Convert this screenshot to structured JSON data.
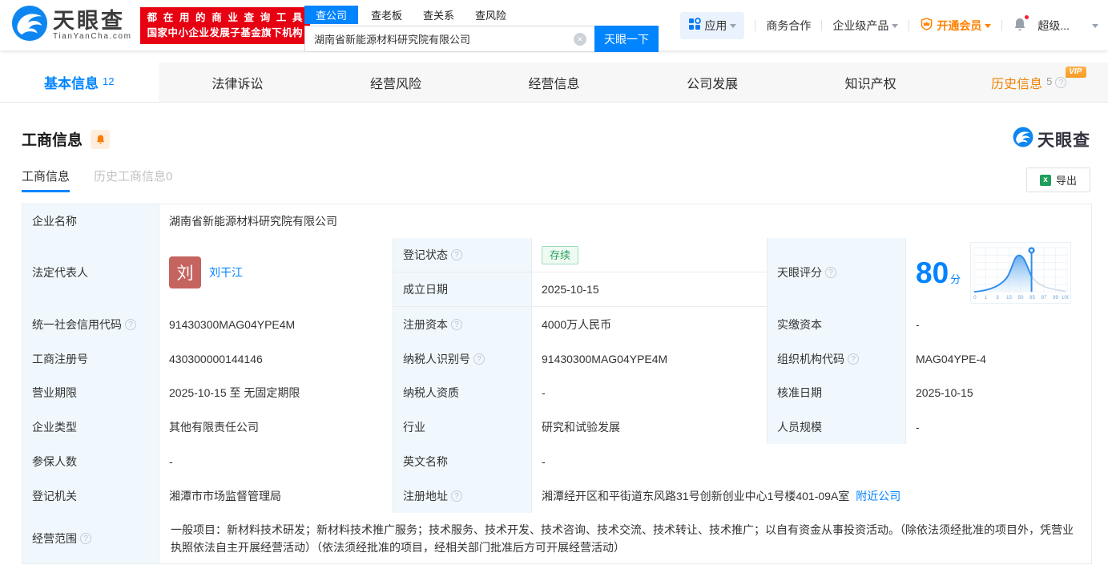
{
  "header": {
    "logo": {
      "name": "天眼查",
      "domain": "TianYanCha.com"
    },
    "promo": {
      "line1": "都在用的商业查询工具",
      "line2": "国家中小企业发展子基金旗下机构"
    },
    "search": {
      "tabs": [
        {
          "label": "查公司",
          "active": true
        },
        {
          "label": "查老板",
          "active": false
        },
        {
          "label": "查关系",
          "active": false
        },
        {
          "label": "查风险",
          "active": false
        }
      ],
      "value": "湖南省新能源材料研究院有限公司",
      "button": "天眼一下"
    },
    "nav": {
      "apps": "应用",
      "cooperation": "商务合作",
      "enterprise": "企业级产品",
      "vip": "开通会员",
      "more": "超级..."
    }
  },
  "tabs": [
    {
      "label": "基本信息",
      "count": "12"
    },
    {
      "label": "法律诉讼",
      "count": ""
    },
    {
      "label": "经营风险",
      "count": ""
    },
    {
      "label": "经营信息",
      "count": ""
    },
    {
      "label": "公司发展",
      "count": ""
    },
    {
      "label": "知识产权",
      "count": ""
    },
    {
      "label": "历史信息",
      "count": "5",
      "vip": "VIP"
    }
  ],
  "section": {
    "title": "工商信息",
    "watermark": "天眼查",
    "subtabs": [
      {
        "label": "工商信息",
        "active": true
      },
      {
        "label": "历史工商信息0",
        "active": false
      }
    ],
    "export_label": "导出"
  },
  "company": {
    "name_label": "企业名称",
    "name": "湖南省新能源材料研究院有限公司",
    "legal_rep_label": "法定代表人",
    "legal_rep_avatar": "刘",
    "legal_rep": "刘干江",
    "reg_status_label": "登记状态",
    "reg_status": "存续",
    "establish_date_label": "成立日期",
    "establish_date": "2025-10-15",
    "score_label": "天眼评分",
    "score": "80",
    "score_unit": "分",
    "credit_code_label": "统一社会信用代码",
    "credit_code": "91430300MAG04YPE4M",
    "reg_capital_label": "注册资本",
    "reg_capital": "4000万人民币",
    "paid_capital_label": "实缴资本",
    "paid_capital": "-",
    "reg_number_label": "工商注册号",
    "reg_number": "430300000144146",
    "taxpayer_id_label": "纳税人识别号",
    "taxpayer_id": "91430300MAG04YPE4M",
    "org_code_label": "组织机构代码",
    "org_code": "MAG04YPE-4",
    "business_term_label": "营业期限",
    "business_term": "2025-10-15 至 无固定期限",
    "taxpayer_quality_label": "纳税人资质",
    "taxpayer_quality": "-",
    "approval_date_label": "核准日期",
    "approval_date": "2025-10-15",
    "company_type_label": "企业类型",
    "company_type": "其他有限责任公司",
    "industry_label": "行业",
    "industry": "研究和试验发展",
    "staff_size_label": "人员规模",
    "staff_size": "-",
    "insured_label": "参保人数",
    "insured": "-",
    "english_name_label": "英文名称",
    "english_name": "-",
    "reg_authority_label": "登记机关",
    "reg_authority": "湘潭市市场监督管理局",
    "address_label": "注册地址",
    "address": "湘潭经开区和平街道东风路31号创新创业中心1号楼401-09A室",
    "nearby_link": "附近公司",
    "scope_label": "经营范围",
    "scope": "一般项目：新材料技术研发；新材料技术推广服务；技术服务、技术开发、技术咨询、技术交流、技术转让、技术推广；以自有资金从事投资活动。（除依法须经批准的项目外，凭营业执照依法自主开展经营活动）（依法须经批准的项目，经相关部门批准后方可开展经营活动）"
  },
  "chart_data": {
    "type": "area",
    "title": "天眼评分",
    "score": 80,
    "marker_tick": "85",
    "x_ticks": [
      "0",
      "1",
      "3",
      "15",
      "50",
      "85",
      "97",
      "99",
      "100"
    ],
    "curve_shape": "right-skewed bell curve peaking near tick 50, filled blue left of marker at tick 85",
    "colors": {
      "fill_top": "#5ea8ef",
      "line": "#2f8ded",
      "rest_line": "#ccd9e6",
      "tick": "#6fa7d8"
    }
  },
  "colors": {
    "brand_blue": "#0084ff",
    "promo_red": "#e60012",
    "orange": "#ff8200",
    "vip_badge": "#f59a23",
    "status_green": "#28a35f",
    "label_bg": "#f0f8fd",
    "avatar_bg": "#c5635f",
    "tabbar_bg": "#f7f7f7"
  }
}
